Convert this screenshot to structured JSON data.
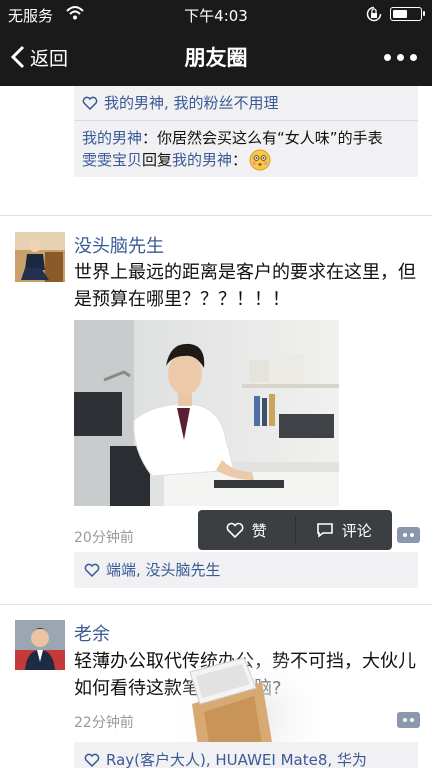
{
  "status_bar": {
    "carrier": "无服务",
    "time": "下午4:03",
    "battery_level": 0.45
  },
  "nav": {
    "back_label": "返回",
    "title": "朋友圈"
  },
  "post_prev": {
    "likes": "我的男神, 我的粉丝不用理",
    "comments": [
      {
        "author": "我的男神",
        "sep": "：",
        "text": "你居然会买这么有“女人味”的手表"
      },
      {
        "author": "雯雯宝贝",
        "reply_word": "回复",
        "target": "我的男神",
        "sep": "：",
        "emoji": "blush"
      }
    ]
  },
  "post1": {
    "author": "没头脑先生",
    "text": "世界上最远的距离是客户的要求在这里，但是预算在哪里？？？！！！",
    "time_ago": "20分钟前",
    "likes": "端端, 没头脑先生"
  },
  "popup": {
    "like_label": "赞",
    "comment_label": "评论"
  },
  "post2": {
    "author": "老余",
    "text": "轻薄办公取代传统办公，势不可挡，大伙儿如何看待这款笔记本电脑?",
    "time_ago": "22分钟前",
    "likes": "Ray(客户大人), HUAWEI Mate8, 华为"
  },
  "colors": {
    "bar_bg": "#1a1a1a",
    "link_blue": "#3a5a96",
    "comment_bg": "#f1f1f3",
    "popup_bg": "#3c3f42"
  }
}
